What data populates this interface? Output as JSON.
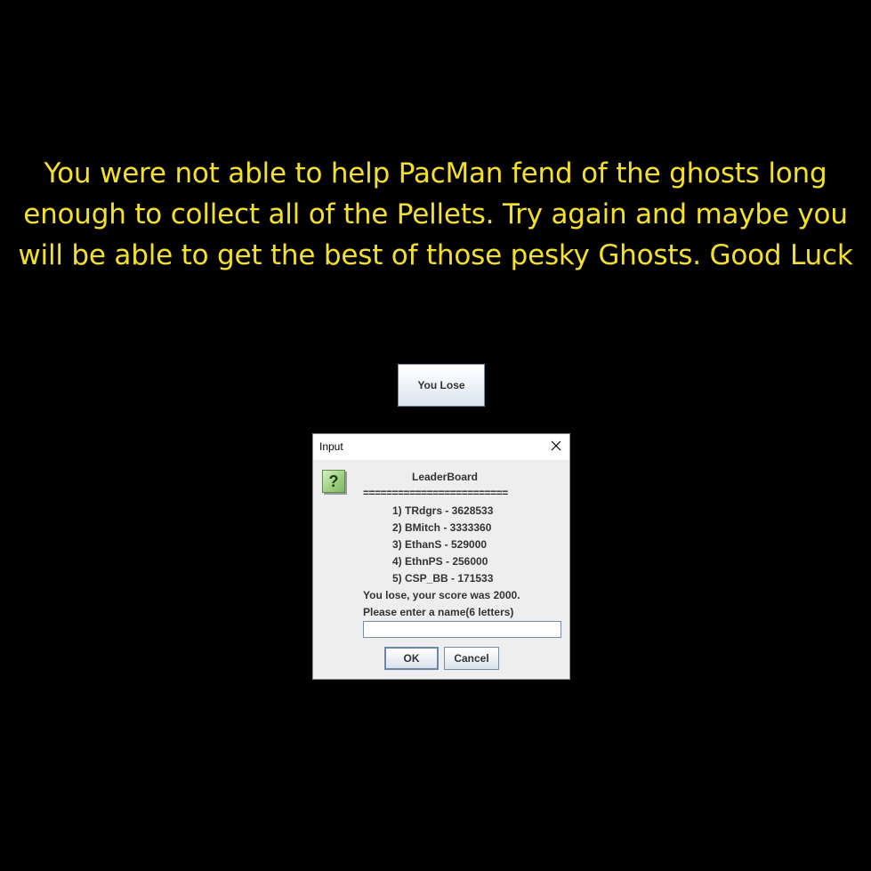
{
  "message": {
    "lines": [
      "You were not able to help PacMan fend of the ghosts long",
      "enough to collect all of the Pellets. Try again and maybe you",
      "will be able to get the best of those pesky Ghosts. Good Luck"
    ]
  },
  "status_button": {
    "label": "You Lose"
  },
  "dialog": {
    "title": "Input",
    "icon": "question-icon",
    "leaderboard_title": "LeaderBoard",
    "separator": "=========================",
    "entries": [
      "1) TRdgrs - 3628533",
      "2) BMitch - 3333360",
      "3) EthanS - 529000",
      "4) EthnPS - 256000",
      "5) CSP_BB - 171533"
    ],
    "score_text": "You lose, your score was 2000.",
    "prompt": "Please enter a name(6 letters)",
    "input_value": "",
    "ok_label": "OK",
    "cancel_label": "Cancel"
  },
  "colors": {
    "background": "#000000",
    "message_text": "#f4e02a"
  }
}
